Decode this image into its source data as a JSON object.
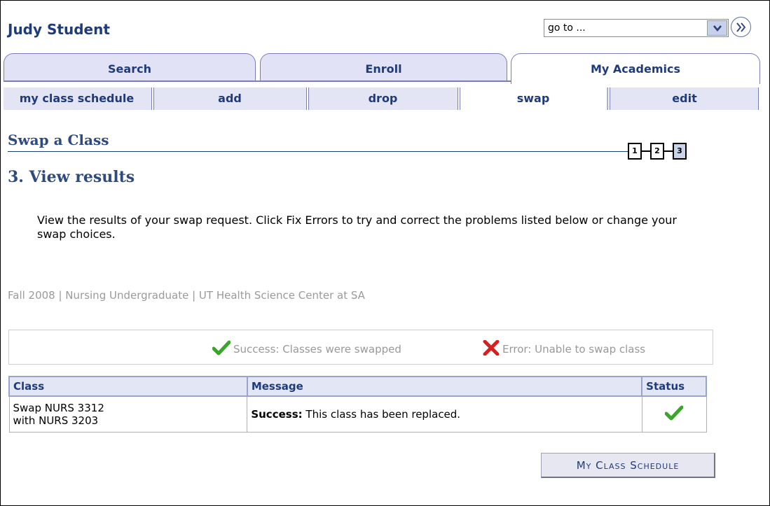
{
  "header": {
    "student_name": "Judy Student",
    "goto_value": "go to ..."
  },
  "tabs": [
    {
      "label": "Search",
      "active": false
    },
    {
      "label": "Enroll",
      "active": false
    },
    {
      "label": "My Academics",
      "active": true
    }
  ],
  "subnav": [
    {
      "label": "my class schedule",
      "active": false
    },
    {
      "label": "add",
      "active": false
    },
    {
      "label": "drop",
      "active": false
    },
    {
      "label": "swap",
      "active": true
    },
    {
      "label": "edit",
      "active": false
    }
  ],
  "page": {
    "title": "Swap a Class",
    "steps": [
      "1",
      "2",
      "3"
    ],
    "current_step": "3",
    "step_heading": "3.  View results",
    "instructions": "View the results of your swap request.  Click Fix Errors to try and correct the problems listed below or change your swap choices.",
    "term_info": "Fall 2008 | Nursing Undergraduate | UT Health Science Center at SA"
  },
  "legend": {
    "success_label": "Success: Classes were swapped",
    "error_label": "Error: Unable to swap class",
    "success_color": "#3aa52b",
    "error_color": "#d61f1f"
  },
  "results_table": {
    "headers": {
      "class": "Class",
      "message": "Message",
      "status": "Status"
    },
    "rows": [
      {
        "class_line1": "Swap NURS 3312",
        "class_line2": "with NURS 3203",
        "message_prefix": "Success:",
        "message_text": "This class has been replaced.",
        "status_icon": "checkmark-icon"
      }
    ]
  },
  "actions": {
    "my_class_schedule_label": "My Class Schedule"
  }
}
